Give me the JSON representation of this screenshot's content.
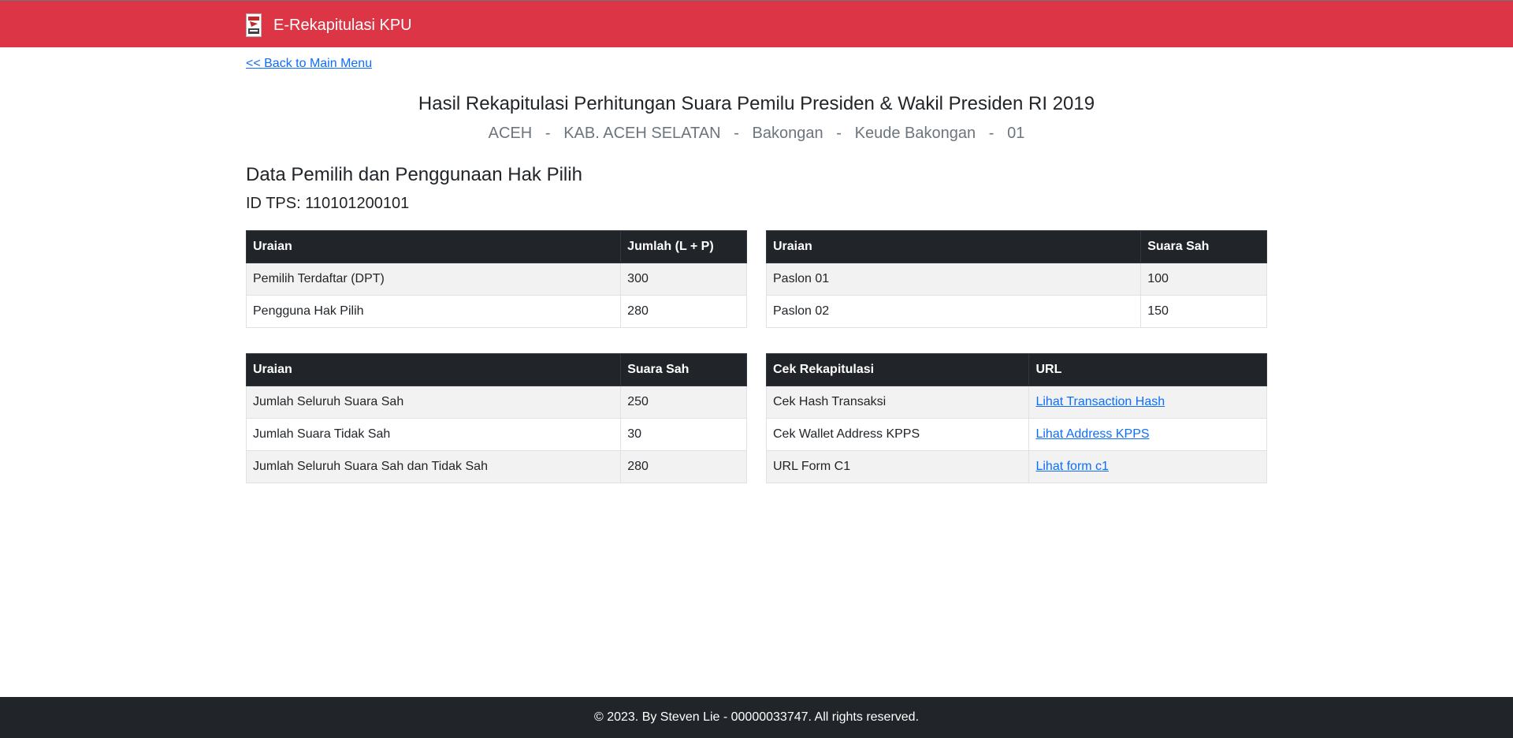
{
  "navbar": {
    "brand": "E-Rekapitulasi KPU",
    "logo_icon": "ballot-box-logo-icon",
    "background": "#dc3545"
  },
  "back_link": "<< Back to Main Menu",
  "header": {
    "title": "Hasil Rekapitulasi Perhitungan Suara Pemilu Presiden & Wakil Presiden RI 2019",
    "location": {
      "province": "ACEH",
      "regency": "KAB. ACEH SELATAN",
      "district": "Bakongan",
      "village": "Keude Bakongan",
      "tps": "01",
      "separator": "-"
    }
  },
  "section": {
    "heading": "Data Pemilih dan Penggunaan Hak Pilih",
    "tps_id": "ID TPS: 110101200101"
  },
  "voters_table": {
    "headers": [
      "Uraian",
      "Jumlah (L + P)"
    ],
    "rows": [
      [
        "Pemilih Terdaftar (DPT)",
        "300"
      ],
      [
        "Pengguna Hak Pilih",
        "280"
      ]
    ]
  },
  "candidates_table": {
    "headers": [
      "Uraian",
      "Suara Sah"
    ],
    "rows": [
      [
        "Paslon 01",
        "100"
      ],
      [
        "Paslon 02",
        "150"
      ]
    ]
  },
  "votes_table": {
    "headers": [
      "Uraian",
      "Suara Sah"
    ],
    "rows": [
      [
        "Jumlah Seluruh Suara Sah",
        "250"
      ],
      [
        "Jumlah Suara Tidak Sah",
        "30"
      ],
      [
        "Jumlah Seluruh Suara Sah dan Tidak Sah",
        "280"
      ]
    ]
  },
  "check_table": {
    "headers": [
      "Cek Rekapitulasi",
      "URL"
    ],
    "rows": [
      [
        "Cek Hash Transaksi",
        "Lihat Transaction Hash"
      ],
      [
        "Cek Wallet Address KPPS",
        "Lihat Address KPPS"
      ],
      [
        "URL Form C1",
        "Lihat form c1"
      ]
    ]
  },
  "footer": {
    "text": "© 2023. By Steven Lie - 00000033747. All rights reserved."
  }
}
